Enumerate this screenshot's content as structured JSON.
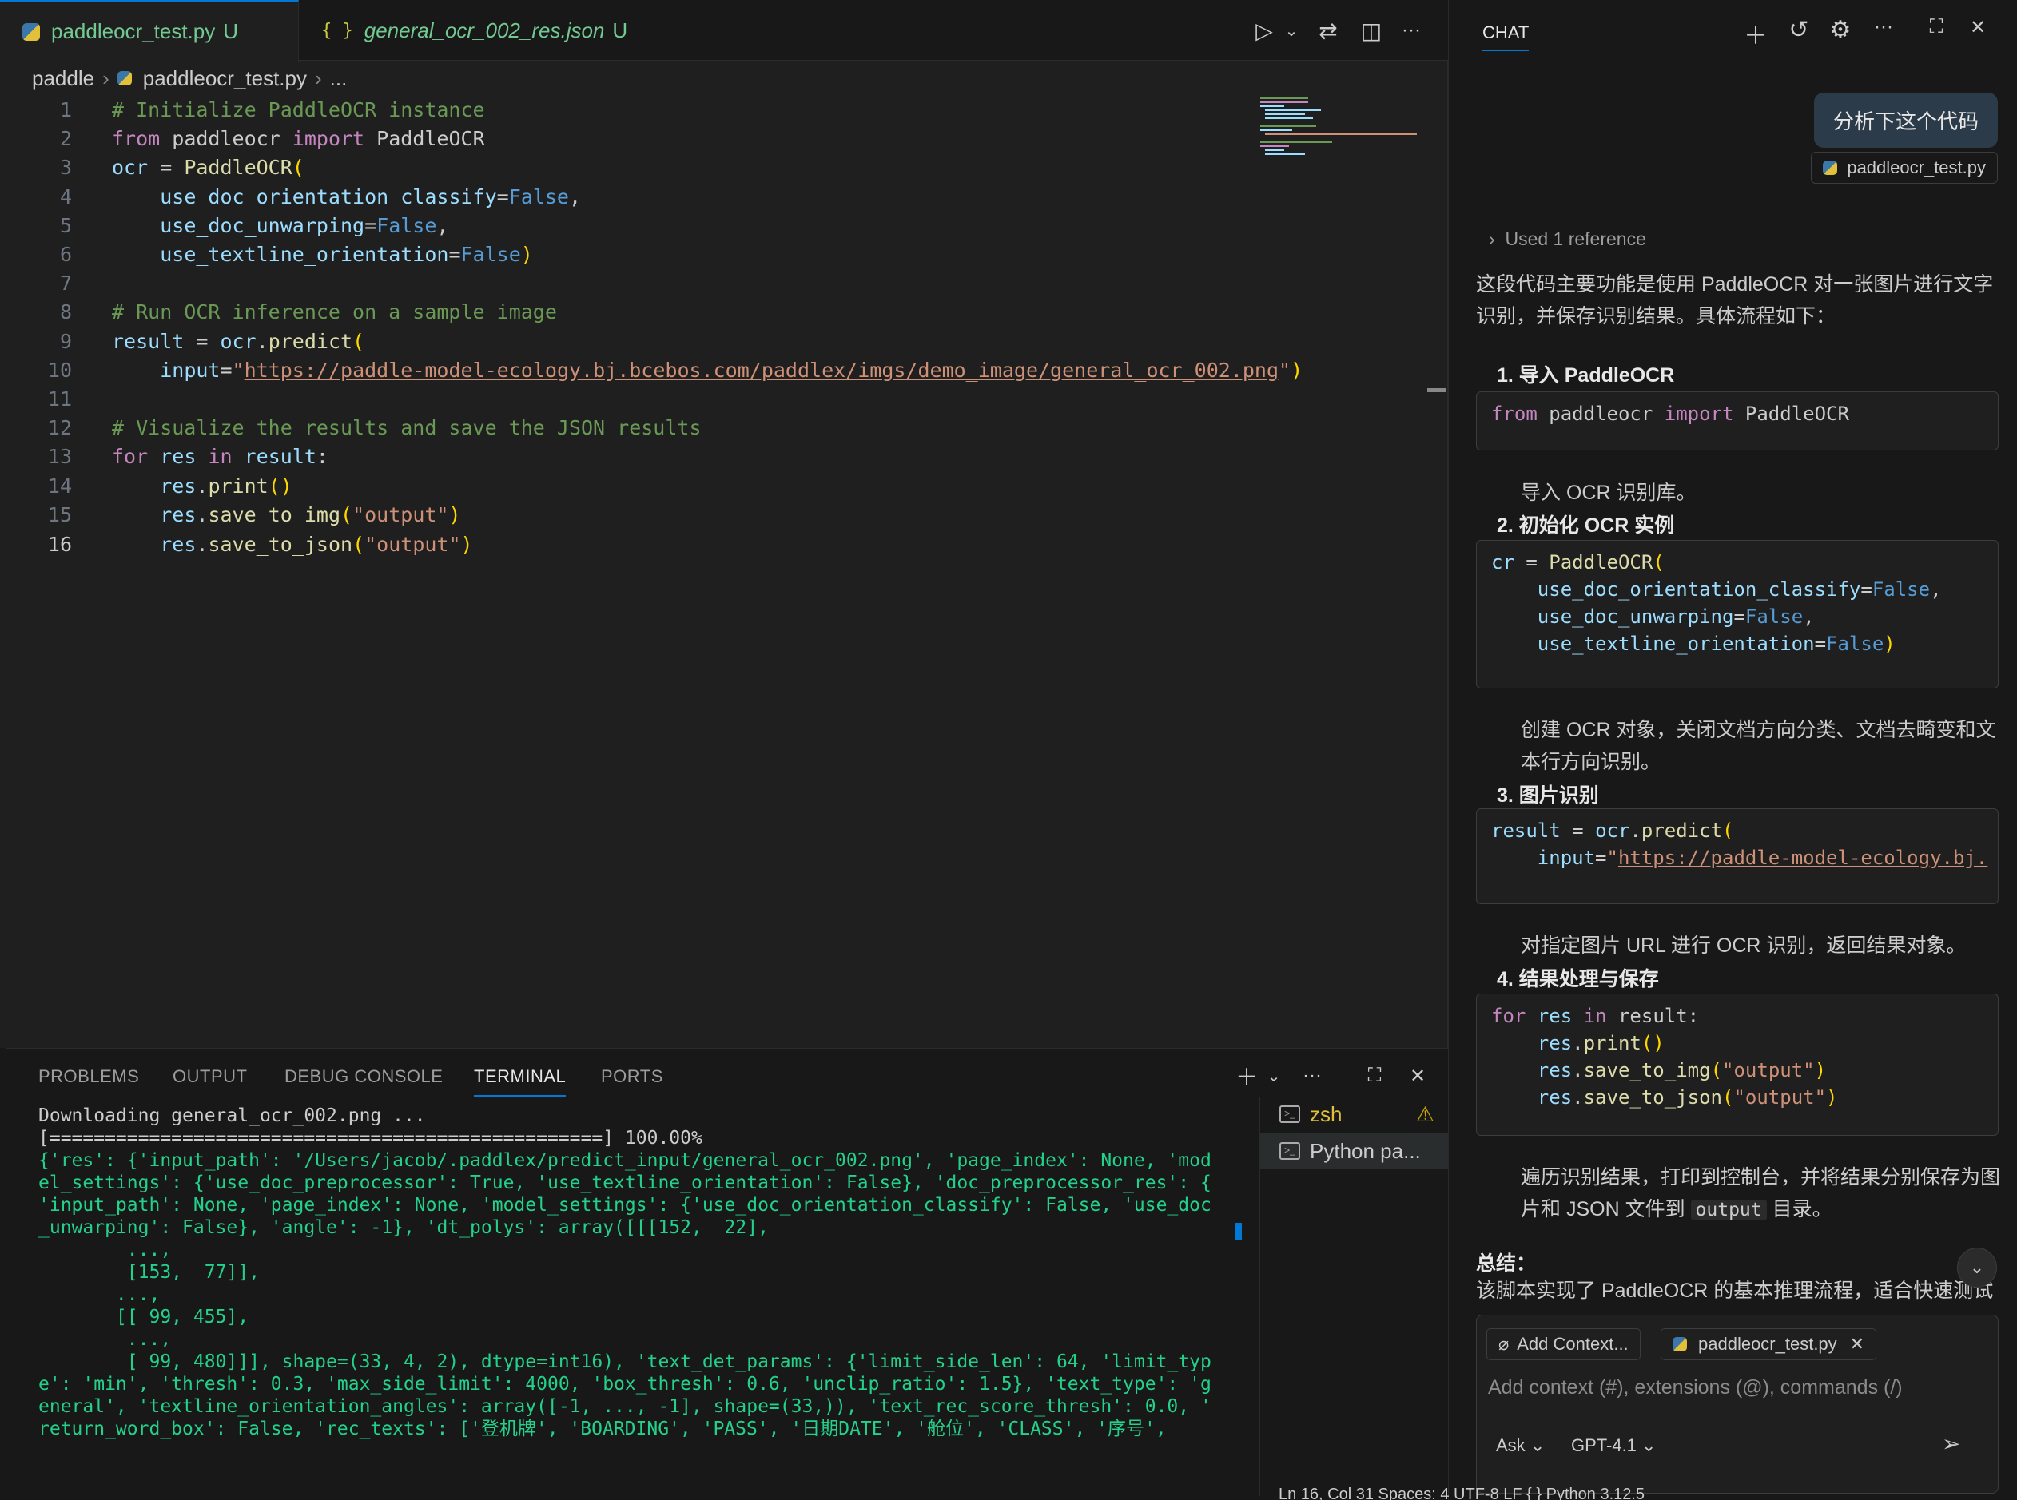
{
  "tabs": [
    {
      "label": "paddleocr_test.py",
      "badge": "U",
      "icon": "python-file-icon"
    },
    {
      "label": "general_ocr_002_res.json",
      "badge": "U",
      "icon": "json-braces-icon",
      "icon_text": "{ }"
    }
  ],
  "toolbar": {
    "run": "▷",
    "run_menu": "⌄",
    "compare": "⇄",
    "split": "◫",
    "more": "···"
  },
  "breadcrumb": {
    "folder": "paddle",
    "file": "paddleocr_test.py",
    "more": "..."
  },
  "code": {
    "current_line": 16,
    "lines": [
      {
        "n": "1",
        "t": "# Initialize PaddleOCR instance"
      },
      {
        "n": "2",
        "t": "from paddleocr import PaddleOCR"
      },
      {
        "n": "3",
        "t": "ocr = PaddleOCR("
      },
      {
        "n": "4",
        "t": "    use_doc_orientation_classify=False,"
      },
      {
        "n": "5",
        "t": "    use_doc_unwarping=False,"
      },
      {
        "n": "6",
        "t": "    use_textline_orientation=False)"
      },
      {
        "n": "7",
        "t": ""
      },
      {
        "n": "8",
        "t": "# Run OCR inference on a sample image"
      },
      {
        "n": "9",
        "t": "result = ocr.predict("
      },
      {
        "n": "10",
        "t": "    input=\"https://paddle-model-ecology.bj.bcebos.com/paddlex/imgs/demo_image/general_ocr_002.png\")"
      },
      {
        "n": "11",
        "t": ""
      },
      {
        "n": "12",
        "t": "# Visualize the results and save the JSON results"
      },
      {
        "n": "13",
        "t": "for res in result:"
      },
      {
        "n": "14",
        "t": "    res.print()"
      },
      {
        "n": "15",
        "t": "    res.save_to_img(\"output\")"
      },
      {
        "n": "16",
        "t": "    res.save_to_json(\"output\")"
      }
    ]
  },
  "panel": {
    "tabs": [
      "PROBLEMS",
      "OUTPUT",
      "DEBUG CONSOLE",
      "TERMINAL",
      "PORTS"
    ],
    "active_tab": "TERMINAL",
    "terminal_lines": [
      "Downloading general_ocr_002.png ...",
      "[==================================================] 100.00%",
      "{'res': {'input_path': '/Users/jacob/.paddlex/predict_input/general_ocr_002.png', 'page_index': None, 'mod",
      "el_settings': {'use_doc_preprocessor': True, 'use_textline_orientation': False}, 'doc_preprocessor_res': {",
      "'input_path': None, 'page_index': None, 'model_settings': {'use_doc_orientation_classify': False, 'use_doc",
      "_unwarping': False}, 'angle': -1}, 'dt_polys': array([[[152,  22],",
      "        ...,",
      "        [153,  77]],",
      "",
      "       ...,",
      "",
      "       [[ 99, 455],",
      "        ...,",
      "        [ 99, 480]]], shape=(33, 4, 2), dtype=int16), 'text_det_params': {'limit_side_len': 64, 'limit_typ",
      "e': 'min', 'thresh': 0.3, 'max_side_limit': 4000, 'box_thresh': 0.6, 'unclip_ratio': 1.5}, 'text_type': 'g",
      "eneral', 'textline_orientation_angles': array([-1, ..., -1], shape=(33,)), 'text_rec_score_thresh': 0.0, '",
      "return_word_box': False, 'rec_texts': ['登机牌', 'BOARDING', 'PASS', '日期DATE', '舱位', 'CLASS', '序号',"
    ],
    "terminals": [
      {
        "label": "zsh",
        "warning": "⚠"
      },
      {
        "label": "Python pa..."
      }
    ]
  },
  "chat": {
    "title": "CHAT",
    "user_message": "分析下这个代码",
    "attached_file": "paddleocr_test.py",
    "used_ref": "Used 1 reference",
    "intro": "这段代码主要功能是使用 PaddleOCR 对一张图片进行文字识别，并保存识别结果。具体流程如下：",
    "steps": [
      {
        "title": "1. 导入 PaddleOCR",
        "code": "from paddleocr import PaddleOCR",
        "desc": "导入 OCR 识别库。"
      },
      {
        "title": "2. 初始化 OCR 实例",
        "code": "cr = PaddleOCR(\n    use_doc_orientation_classify=False,\n    use_doc_unwarping=False,\n    use_textline_orientation=False)",
        "desc": "创建 OCR 对象，关闭文档方向分类、文档去畸变和文本行方向识别。"
      },
      {
        "title": "3. 图片识别",
        "code": "result = ocr.predict(\n    input=\"https://paddle-model-ecology.bj.",
        "desc": "对指定图片 URL 进行 OCR 识别，返回结果对象。"
      },
      {
        "title": "4. 结果处理与保存",
        "code": "for res in result:\n    res.print()\n    res.save_to_img(\"output\")\n    res.save_to_json(\"output\")",
        "desc_before": "遍历识别结果，打印到控制台，并将结果分别保存为图片和 JSON 文件到",
        "desc_code": "output",
        "desc_after": "目录。"
      }
    ],
    "summary_title": "总结：",
    "summary_text": "该脚本实现了 PaddleOCR 的基本推理流程，适合快速测试",
    "input": {
      "add_context": "Add Context...",
      "file_chip": "paddleocr_test.py",
      "placeholder": "Add context (#), extensions (@), commands (/)",
      "mode": "Ask",
      "model": "GPT-4.1"
    }
  },
  "status": {
    "text": "Ln 16, Col 31    Spaces: 4    UTF-8    LF    { } Python    3.12.5"
  }
}
